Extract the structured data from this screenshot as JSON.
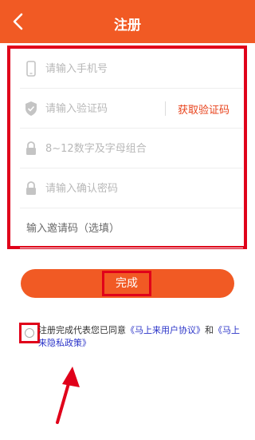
{
  "header": {
    "title": "注册",
    "back_icon": "chevron-left-icon",
    "background": "#f15a24"
  },
  "form": {
    "phone": {
      "placeholder": "请输入手机号",
      "icon": "phone-icon"
    },
    "code": {
      "placeholder": "请输入验证码",
      "icon": "shield-icon",
      "get_code_label": "获取验证码"
    },
    "password": {
      "placeholder": "8~12数字及字母组合",
      "icon": "lock-icon"
    },
    "confirm_password": {
      "placeholder": "请输入确认密码",
      "icon": "lock-icon"
    },
    "invite": {
      "placeholder": "输入邀请码（选填）"
    }
  },
  "submit": {
    "label": "完成"
  },
  "agreement": {
    "prefix": "注册完成代表您已同意",
    "user_agreement": "《马上来用户协议》",
    "connector": "和",
    "privacy_policy": "《马上来隐私政策》"
  },
  "colors": {
    "accent": "#f15a24",
    "highlight_box": "#e0001a",
    "link": "#2a33c8"
  }
}
